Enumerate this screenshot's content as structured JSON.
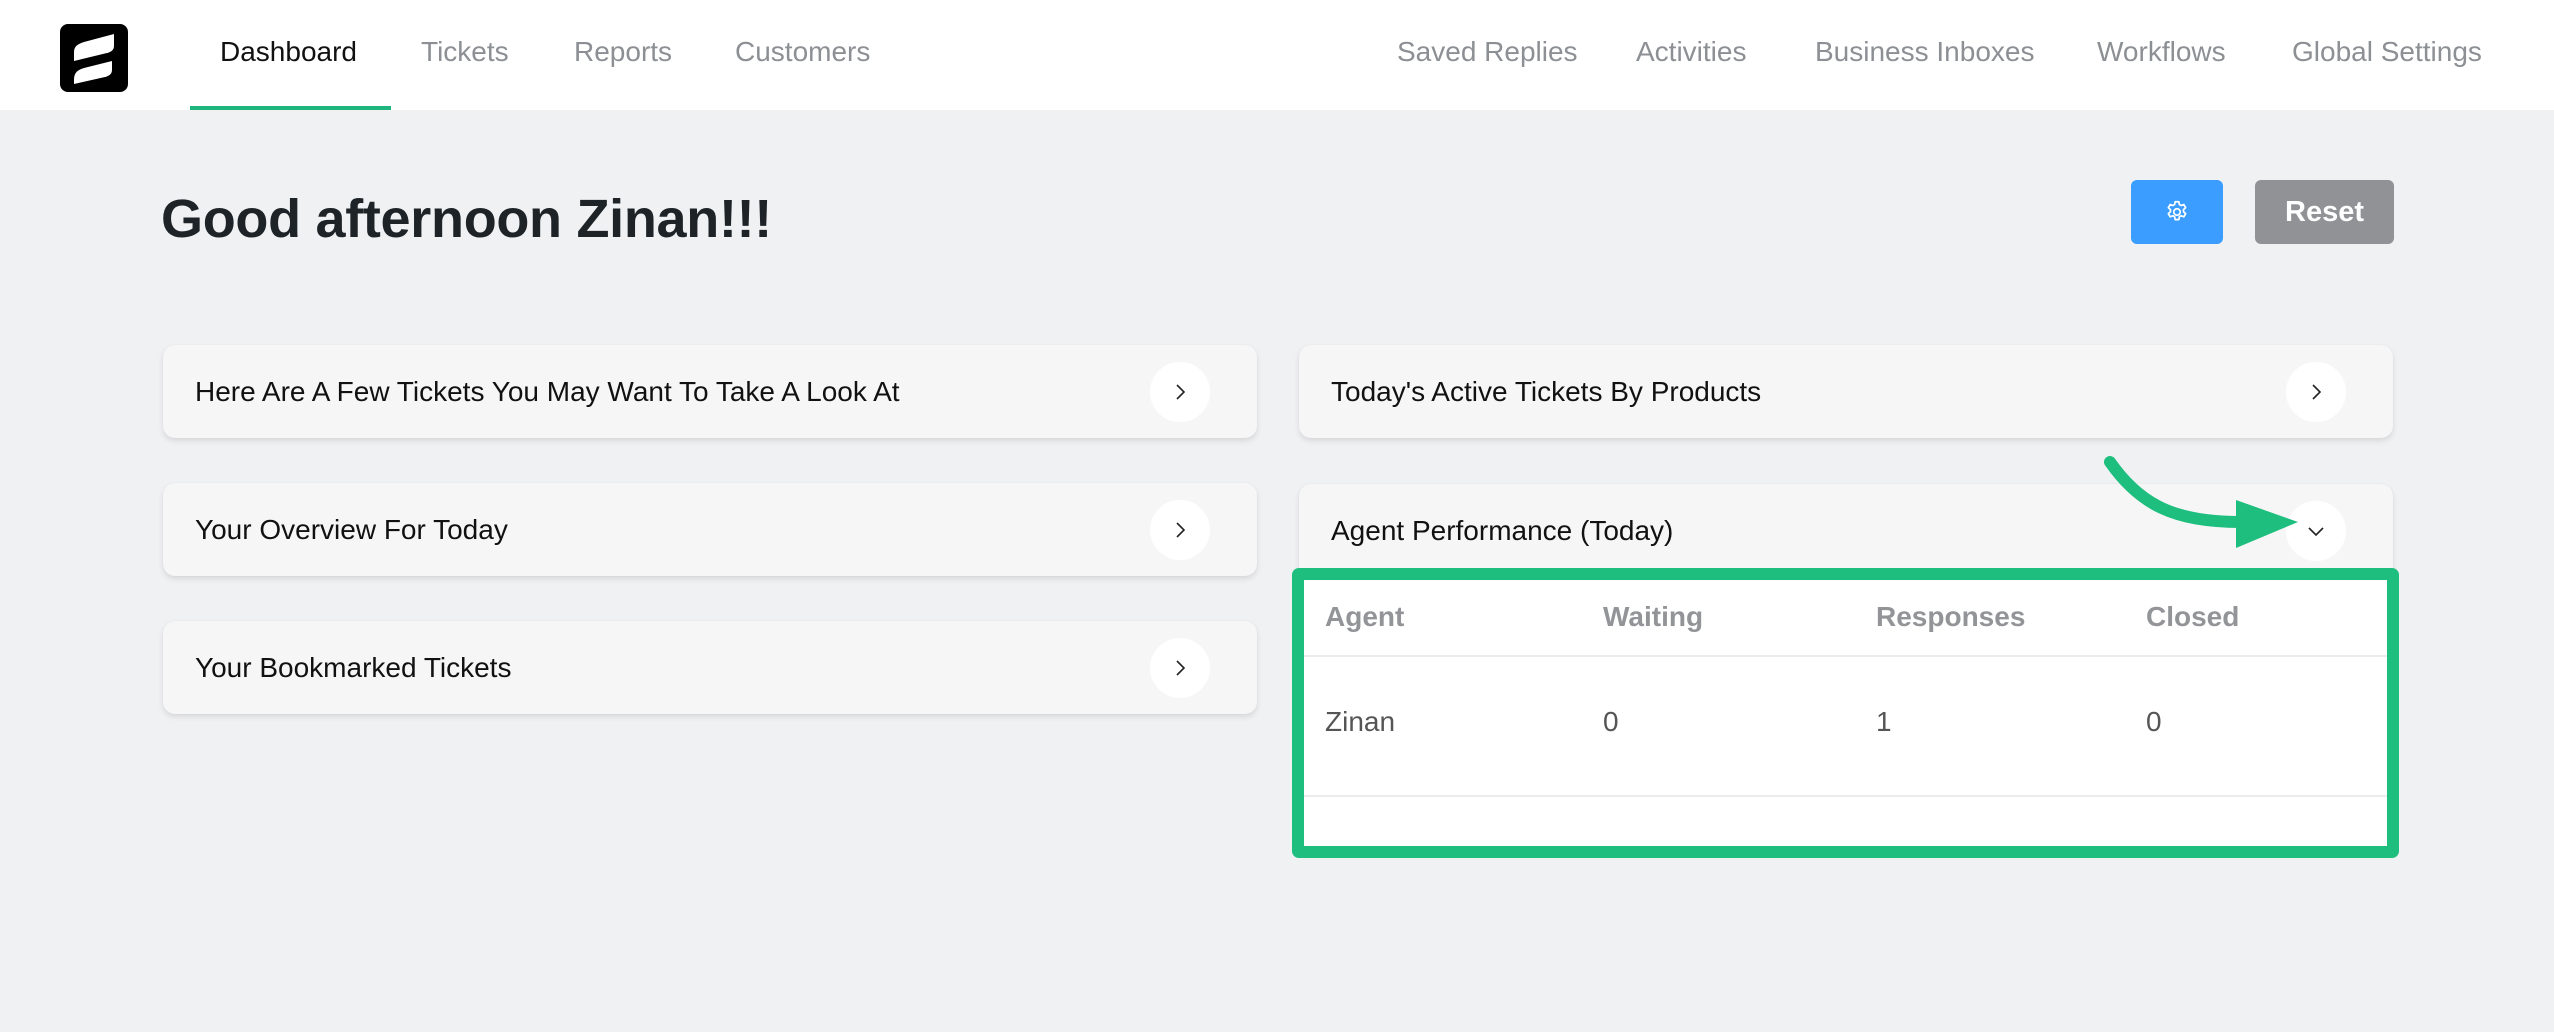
{
  "header": {
    "logo": "fluent-support-logo-icon",
    "nav_left": [
      {
        "label": "Dashboard",
        "active": true
      },
      {
        "label": "Tickets",
        "active": false
      },
      {
        "label": "Reports",
        "active": false
      },
      {
        "label": "Customers",
        "active": false
      }
    ],
    "nav_right": [
      {
        "label": "Saved Replies"
      },
      {
        "label": "Activities"
      },
      {
        "label": "Business Inboxes"
      },
      {
        "label": "Workflows"
      },
      {
        "label": "Global Settings"
      }
    ],
    "active_color": "#1fb57c"
  },
  "page": {
    "greeting": "Good afternoon Zinan!!!",
    "settings_button_icon": "gear-icon",
    "reset_label": "Reset"
  },
  "left_cards": [
    {
      "title": "Here Are A Few Tickets You May Want To Take A Look At",
      "icon": "chevron-right-icon"
    },
    {
      "title": "Your Overview For Today",
      "icon": "chevron-right-icon"
    },
    {
      "title": "Your Bookmarked Tickets",
      "icon": "chevron-right-icon"
    }
  ],
  "right_cards": [
    {
      "title": "Today's Active Tickets By Products",
      "icon": "chevron-right-icon"
    },
    {
      "title": "Agent Performance (Today)",
      "icon": "chevron-down-icon",
      "expanded": true
    }
  ],
  "agent_performance": {
    "columns": [
      "Agent",
      "Waiting",
      "Responses",
      "Closed"
    ],
    "rows": [
      [
        "Zinan",
        "0",
        "1",
        "0"
      ]
    ]
  },
  "annotation": {
    "color": "#1ebe7e",
    "arrow_icon": "curved-arrow-icon"
  }
}
